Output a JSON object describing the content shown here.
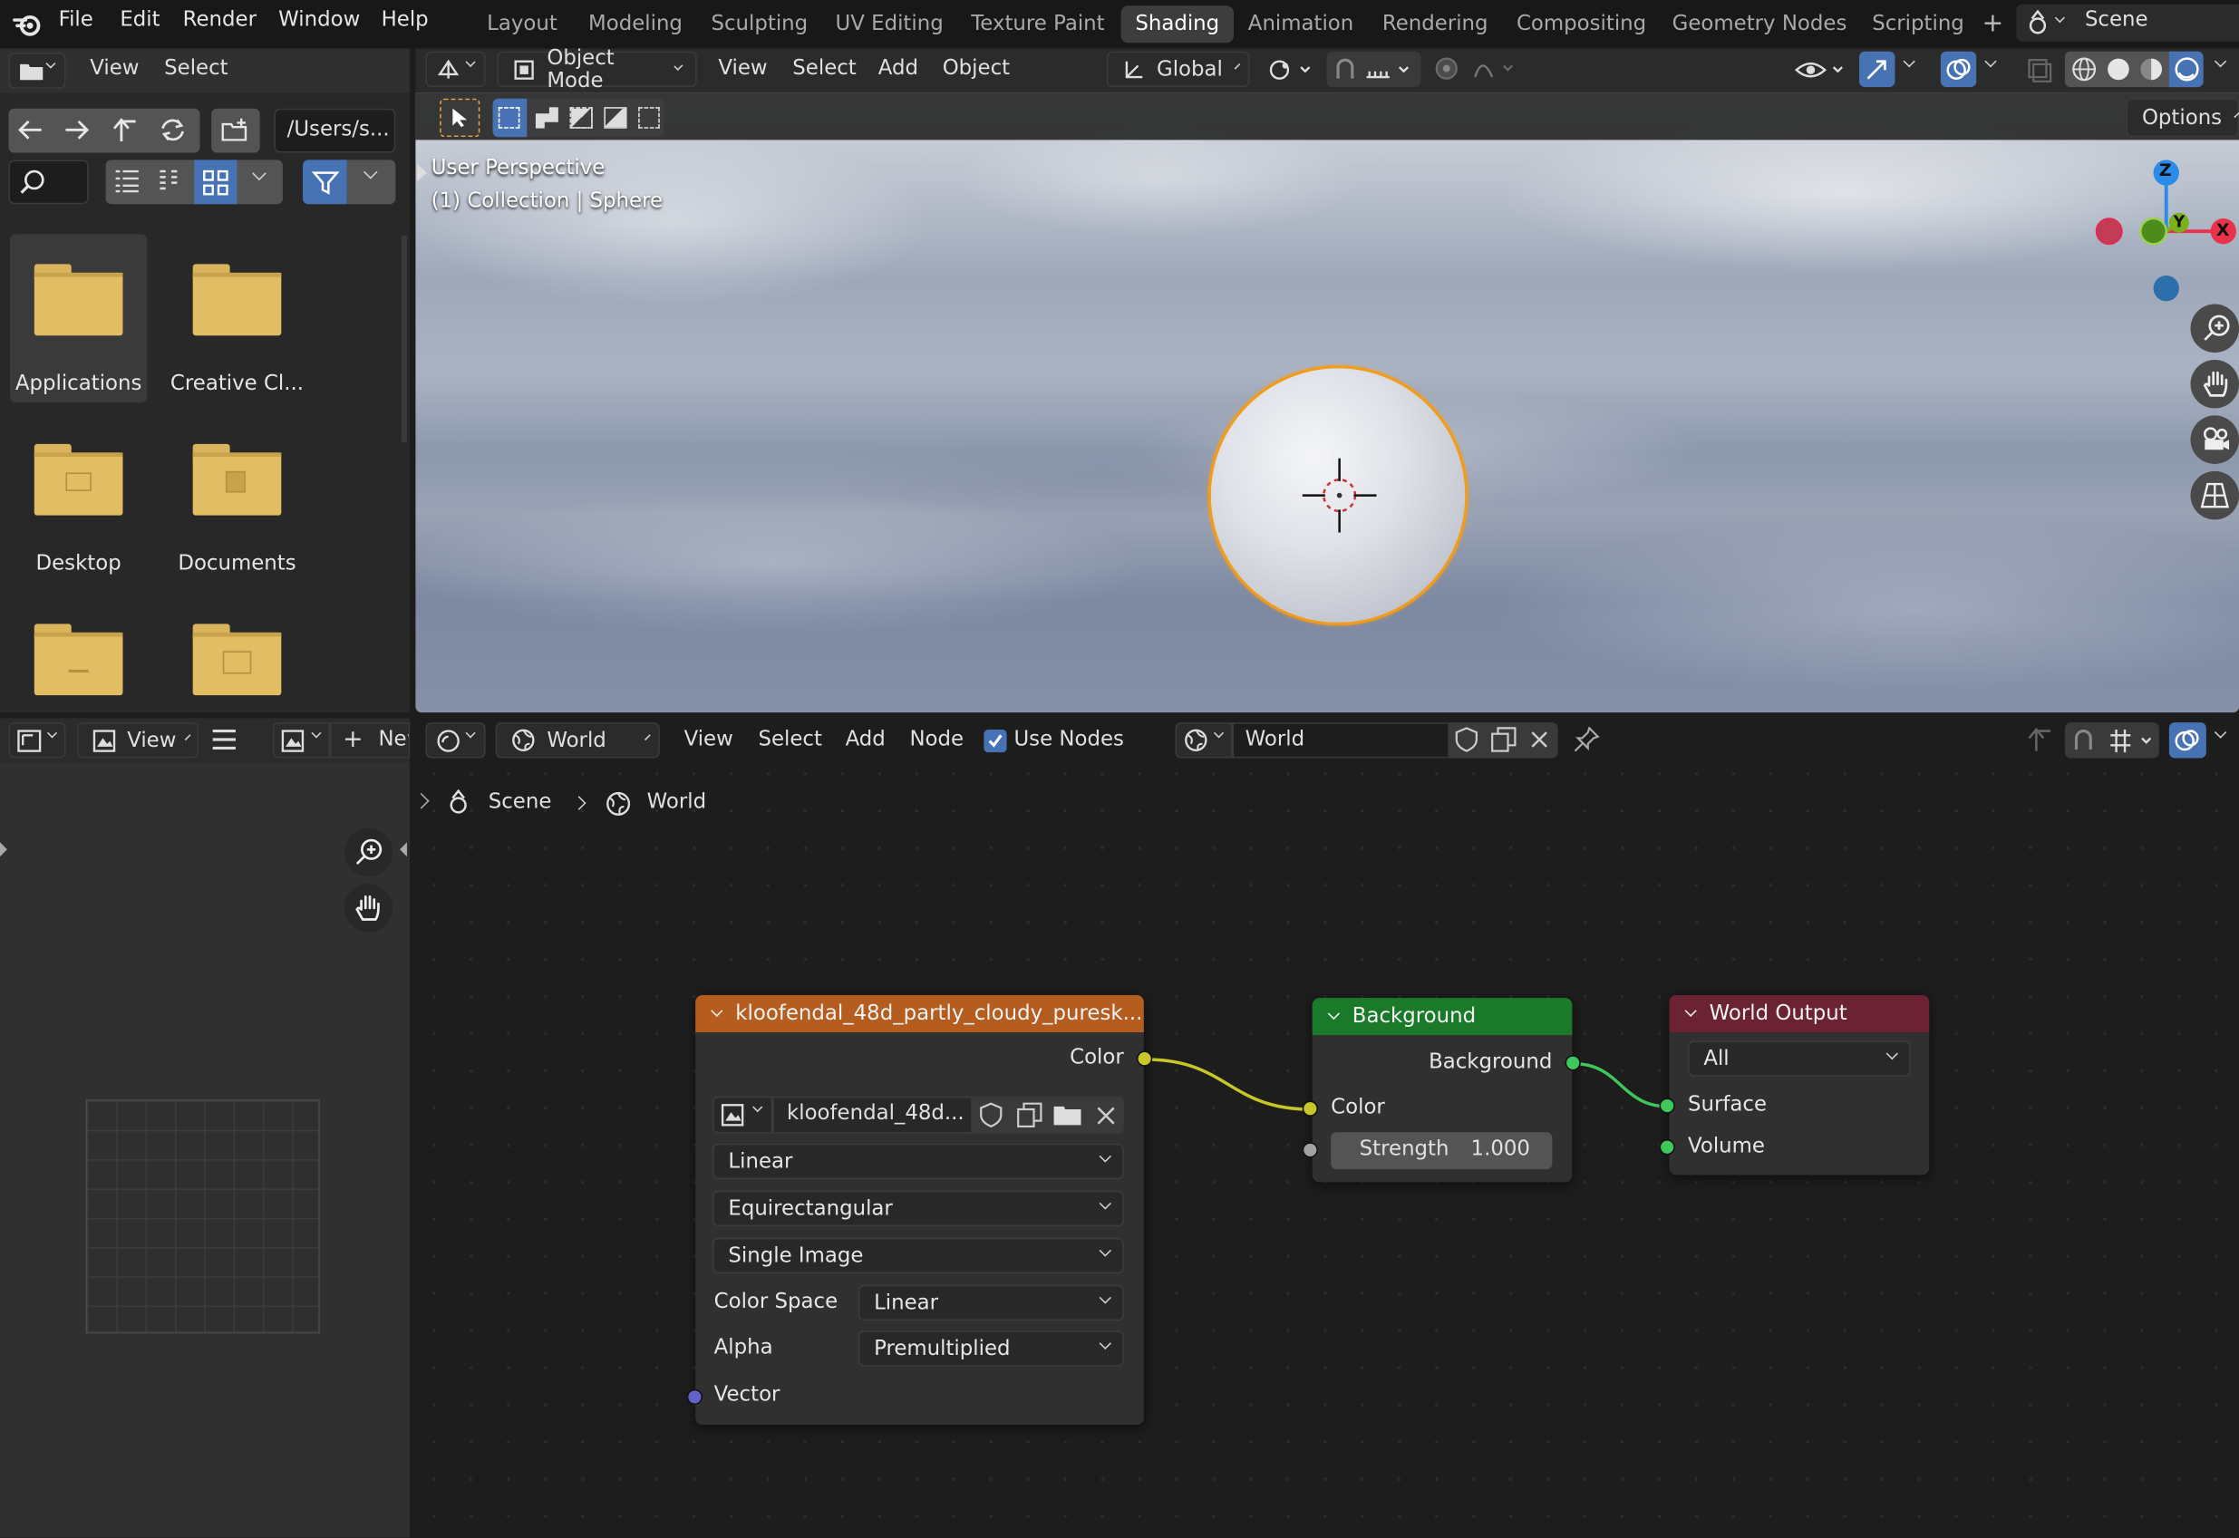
{
  "top_menu": {
    "items": [
      "File",
      "Edit",
      "Render",
      "Window",
      "Help"
    ]
  },
  "workspaces": {
    "tabs": [
      "Layout",
      "Modeling",
      "Sculpting",
      "UV Editing",
      "Texture Paint",
      "Shading",
      "Animation",
      "Rendering",
      "Compositing",
      "Geometry Nodes",
      "Scripting"
    ],
    "active": "Shading",
    "add": "+"
  },
  "scene": {
    "label": "Scene"
  },
  "file_browser": {
    "menu": [
      "View",
      "Select"
    ],
    "path": "/Users/s...",
    "items": [
      {
        "name": "Applications",
        "selected": true
      },
      {
        "name": "Creative Cl..."
      },
      {
        "name": "Desktop"
      },
      {
        "name": "Documents"
      },
      {
        "name": ""
      },
      {
        "name": ""
      }
    ]
  },
  "viewport": {
    "mode": "Object Mode",
    "menu": [
      "View",
      "Select",
      "Add",
      "Object"
    ],
    "transform": "Global",
    "options": "Options",
    "overlay_line1": "User Perspective",
    "overlay_line2": "(1) Collection | Sphere",
    "gizmo": {
      "z": "Z",
      "y": "Y",
      "x": "X"
    }
  },
  "image_editor": {
    "view": "View",
    "new": "New"
  },
  "node_editor": {
    "menu": [
      "View",
      "Select",
      "Add",
      "Node"
    ],
    "use_nodes": "Use Nodes",
    "type": "World",
    "world_name": "World",
    "breadcrumb": [
      "Scene",
      "World"
    ],
    "image_node": {
      "title": "kloofendal_48d_partly_cloudy_puresk...",
      "out_color": "Color",
      "image_name": "kloofendal_48d...",
      "interp": "Linear",
      "projection": "Equirectangular",
      "source": "Single Image",
      "color_space_label": "Color Space",
      "color_space": "Linear",
      "alpha_label": "Alpha",
      "alpha": "Premultiplied",
      "in_vector": "Vector"
    },
    "bg_node": {
      "title": "Background",
      "out": "Background",
      "in_color": "Color",
      "strength_label": "Strength",
      "strength": "1.000"
    },
    "out_node": {
      "title": "World Output",
      "target": "All",
      "surface": "Surface",
      "volume": "Volume"
    }
  },
  "colors": {
    "accent": "#4772b3",
    "image_header": "#b45d1f",
    "bg_header": "#1a7a2a",
    "out_header": "#6b2233",
    "socket_yellow": "#c7c729",
    "socket_green": "#3fc85a",
    "socket_purple": "#6363c7",
    "socket_grey": "#a1a1a1",
    "selection": "#f39c1b"
  }
}
